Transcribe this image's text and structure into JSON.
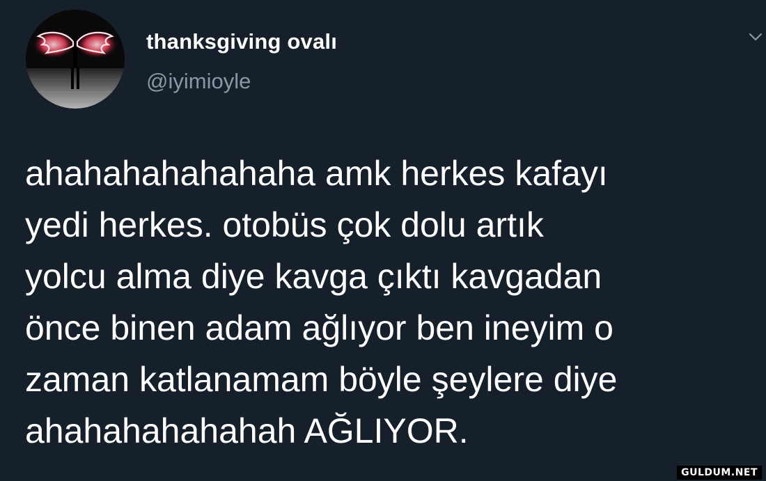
{
  "user": {
    "display_name": "thanksgiving ovalı",
    "handle": "@iyimioyle",
    "avatar": "avatar-neon-wings-image"
  },
  "menu": {
    "icon": "chevron-down-icon"
  },
  "tweet": {
    "lines": [
      "ahahahahahahaha amk herkes kafayı",
      "yedi herkes. otobüs çok dolu artık",
      "yolcu alma diye kavga çıktı kavgadan",
      "önce binen adam ağlıyor ben ineyim o",
      "zaman katlanamam böyle şeylere diye",
      "ahahahahahahah AĞLIYOR."
    ]
  },
  "watermark": "GULDUM.NET",
  "colors": {
    "background": "#15202b",
    "text": "#ffffff",
    "secondary_text": "#8899a6"
  }
}
